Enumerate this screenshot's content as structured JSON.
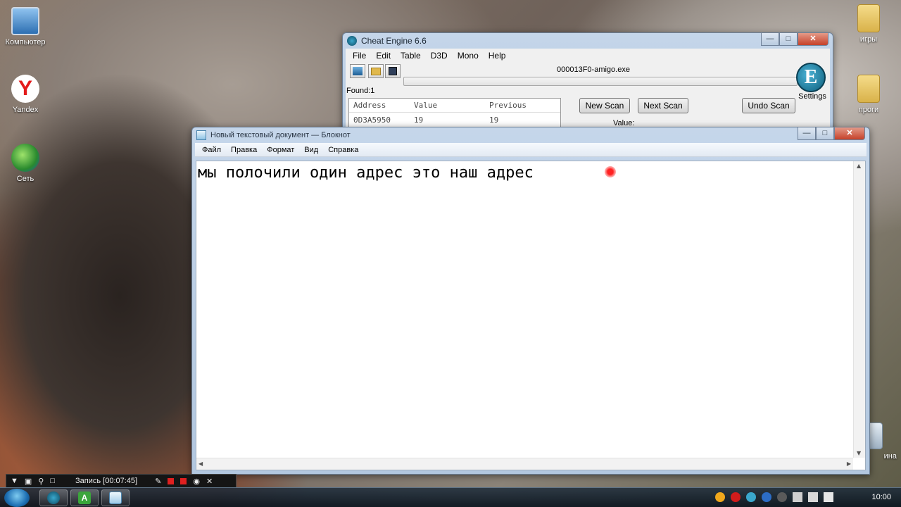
{
  "desktop": {
    "icons_left": [
      {
        "label": "Компьютер",
        "icon": "computer-icon"
      },
      {
        "label": "Yandex",
        "icon": "yandex-icon"
      },
      {
        "label": "Сеть",
        "icon": "network-icon"
      }
    ],
    "icons_right": [
      {
        "label": "игры",
        "icon": "folder-icon"
      },
      {
        "label": "проги",
        "icon": "folder-icon"
      }
    ],
    "partial_label": "ина"
  },
  "cheat_engine": {
    "title": "Cheat Engine 6.6",
    "menu": [
      "File",
      "Edit",
      "Table",
      "D3D",
      "Mono",
      "Help"
    ],
    "process": "000013F0-amigo.exe",
    "found": "Found:1",
    "columns": [
      "Address",
      "Value",
      "Previous"
    ],
    "rows": [
      {
        "address": "0D3A5950",
        "value": "19",
        "previous": "19"
      }
    ],
    "buttons": {
      "new_scan": "New Scan",
      "next_scan": "Next Scan",
      "undo_scan": "Undo Scan"
    },
    "value_label": "Value:",
    "settings_label": "Settings"
  },
  "notepad": {
    "title": "Новый текстовый документ — Блокнот",
    "menu": [
      "Файл",
      "Правка",
      "Формат",
      "Вид",
      "Справка"
    ],
    "content": "мы полочили один адрес это наш адрес"
  },
  "recorder": {
    "status": "Запись [00:07:45]"
  },
  "taskbar": {
    "clock": "10:00",
    "apps": [
      "cheat-engine",
      "amigo",
      "notepad"
    ]
  },
  "colors": {
    "window_frame": "#b2c7df",
    "close_button": "#c6412a",
    "record_red": "#e02020"
  }
}
